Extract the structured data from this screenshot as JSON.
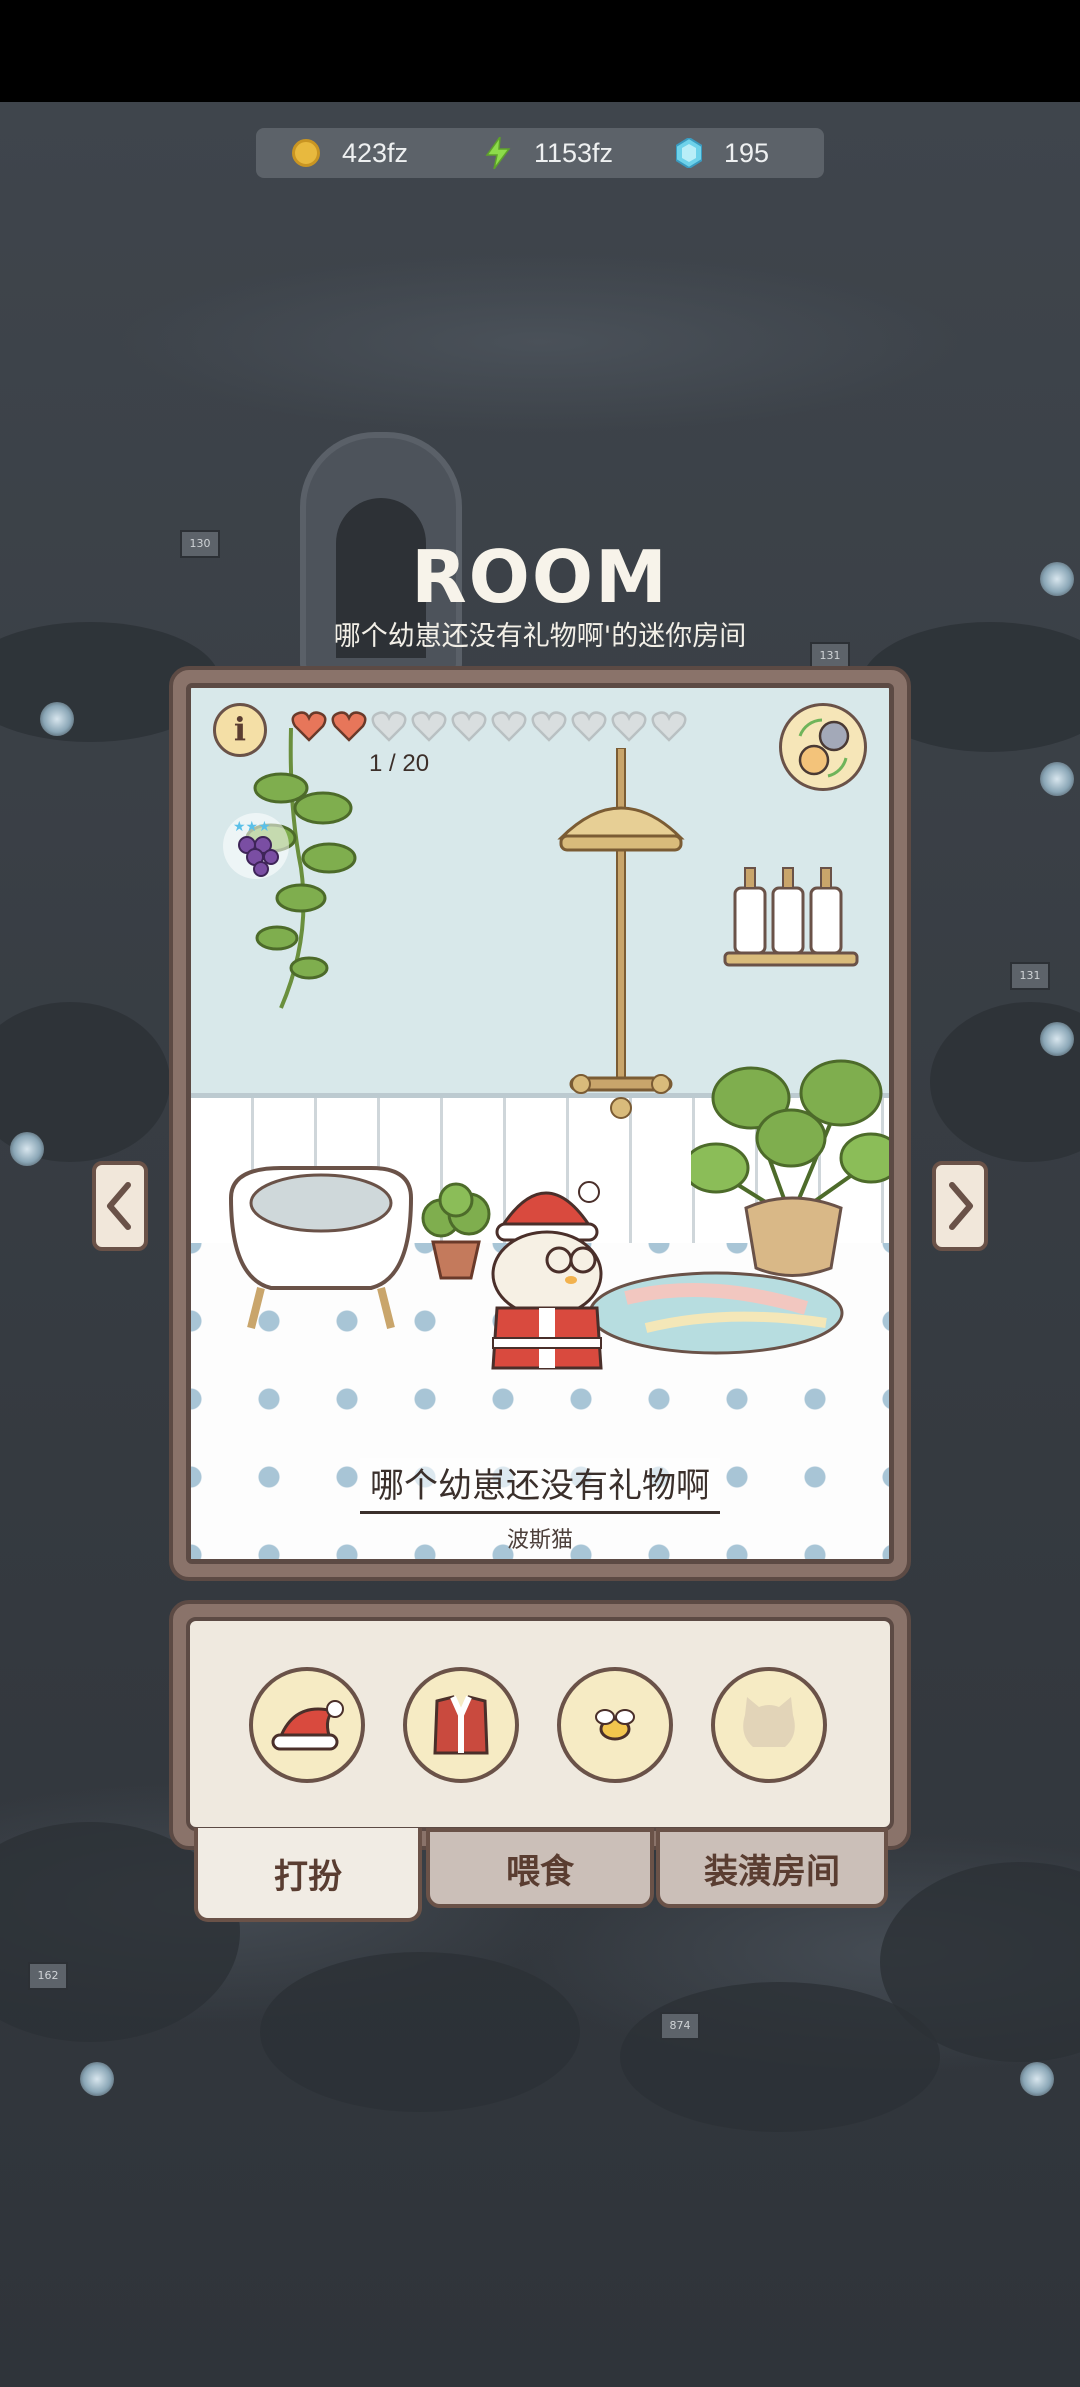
{
  "currency": {
    "coins": "423fz",
    "energy": "1153fz",
    "gems": "195"
  },
  "header": {
    "title": "ROOM",
    "subtitle": "哪个幼崽还没有礼物啊'的迷你房间"
  },
  "room": {
    "info_label": "i",
    "affection": {
      "filled": 2,
      "total": 10,
      "progress_text": "1 / 20"
    },
    "cat_name": "哪个幼崽还没有礼物啊",
    "cat_breed": "波斯猫"
  },
  "dress_items": [
    {
      "icon": "santa-hat-icon"
    },
    {
      "icon": "santa-vest-icon"
    },
    {
      "icon": "bee-icon"
    },
    {
      "icon": "cat-silhouette-icon"
    }
  ],
  "tabs": {
    "dress_up": "打扮",
    "feed": "喂食",
    "decorate": "装潢房间"
  },
  "colors": {
    "heart_filled": "#e7765a",
    "heart_empty": "#d9dedf",
    "panel_brown": "#8a736a",
    "outline": "#5c4a44"
  }
}
